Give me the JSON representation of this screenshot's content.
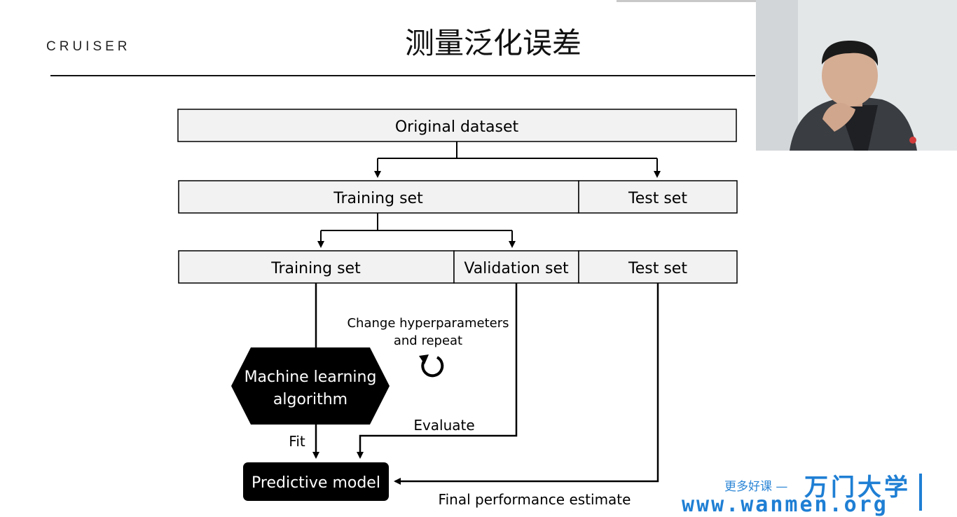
{
  "header": {
    "logo": "CRUISER",
    "title": "测量泛化误差"
  },
  "diagram": {
    "original_dataset": "Original dataset",
    "split1_training": "Training set",
    "split1_test": "Test set",
    "split2_training": "Training set",
    "split2_validation": "Validation set",
    "split2_test": "Test set",
    "change_line1": "Change hyperparameters",
    "change_line2": "and repeat",
    "ml_line1": "Machine learning",
    "ml_line2": "algorithm",
    "fit": "Fit",
    "evaluate": "Evaluate",
    "predictive_model": "Predictive model",
    "final_estimate": "Final performance estimate"
  },
  "promo": {
    "slogan": "更多好课 —",
    "brand": "万门大学",
    "url": "www.wanmen.org"
  },
  "colors": {
    "box_fill": "#f2f2f2",
    "dark_fill": "#000000",
    "accent": "#1f7fd4"
  }
}
